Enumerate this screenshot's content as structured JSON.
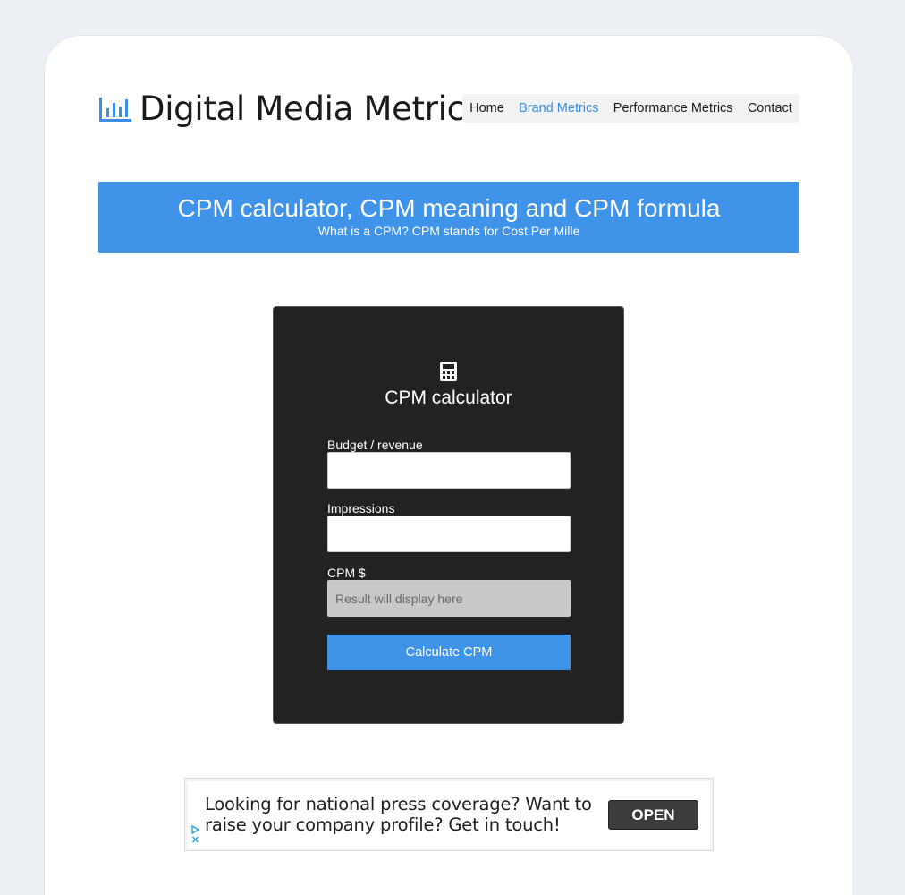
{
  "site": {
    "logo_icon": "bar-chart-icon",
    "title": "Digital Media Metrics",
    "accent_color": "#3f93e8"
  },
  "nav": {
    "items": [
      {
        "label": "Home"
      },
      {
        "label": "Brand Metrics",
        "active": true
      },
      {
        "label": "Performance Metrics"
      },
      {
        "label": "Contact"
      }
    ]
  },
  "banner": {
    "title": "CPM calculator, CPM meaning and CPM formula",
    "subtitle": "What is a CPM? CPM stands for Cost Per Mille"
  },
  "calculator": {
    "icon": "calculator-icon",
    "title": "CPM calculator",
    "budget_label": "Budget / revenue",
    "budget_value": "",
    "impressions_label": "Impressions",
    "impressions_value": "",
    "cpm_label": "CPM $",
    "cpm_placeholder": "Result will display here",
    "button_label": "Calculate CPM"
  },
  "ad": {
    "text_line1": "Looking for national press coverage? Want to",
    "text_line2": "raise your company profile? Get in touch!",
    "button_label": "OPEN",
    "icons": [
      "adchoices-icon",
      "close-icon"
    ]
  }
}
